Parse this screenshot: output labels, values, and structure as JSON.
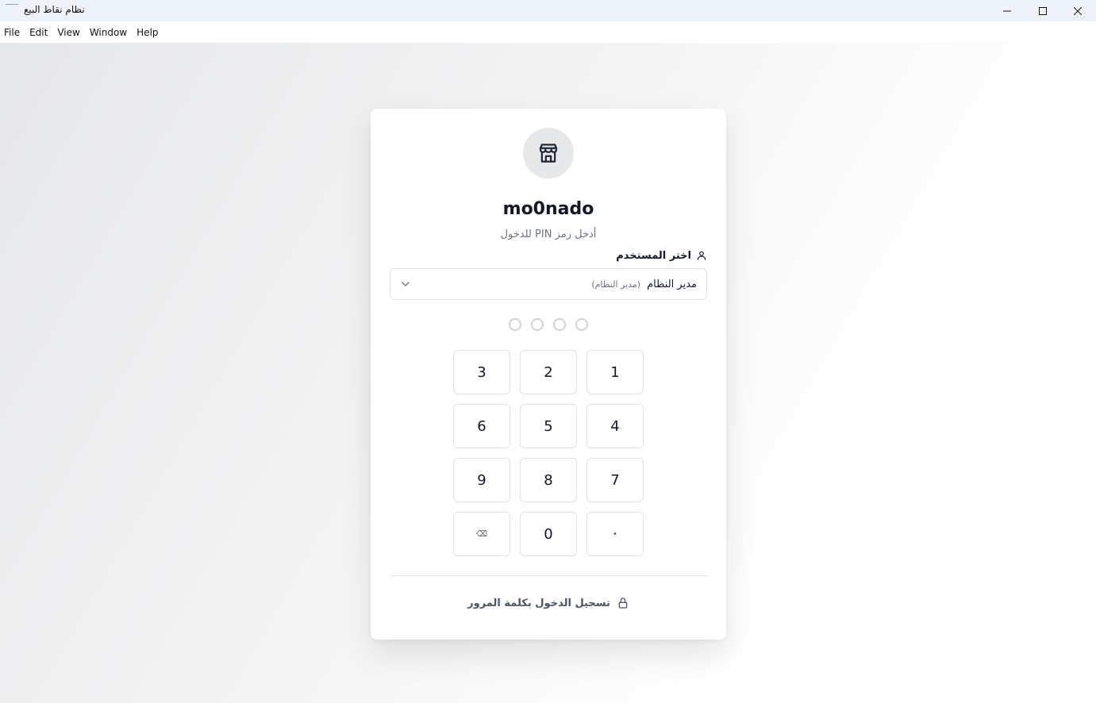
{
  "window": {
    "title": "نظام نقاط البيع",
    "minimize_icon": "minimize-icon",
    "maximize_icon": "maximize-icon",
    "close_icon": "close-icon"
  },
  "menu": {
    "items": [
      "File",
      "Edit",
      "View",
      "Window",
      "Help"
    ]
  },
  "login": {
    "logo_icon": "store-icon",
    "brand": "mo0nado",
    "subtitle": "أدخل رمز PIN للدخول",
    "user_label": "اختر المستخدم",
    "user_icon": "user-icon",
    "selected_user": "مدير النظام",
    "selected_role": "(مدير النظام)",
    "pin_length": 4,
    "pin_filled": 0,
    "keys": [
      "3",
      "2",
      "1",
      "6",
      "5",
      "4",
      "9",
      "8",
      "7",
      "⌫",
      "0",
      "•"
    ],
    "password_login_label": "تسجيل الدخول بكلمة المرور",
    "password_login_icon": "lock-icon"
  }
}
